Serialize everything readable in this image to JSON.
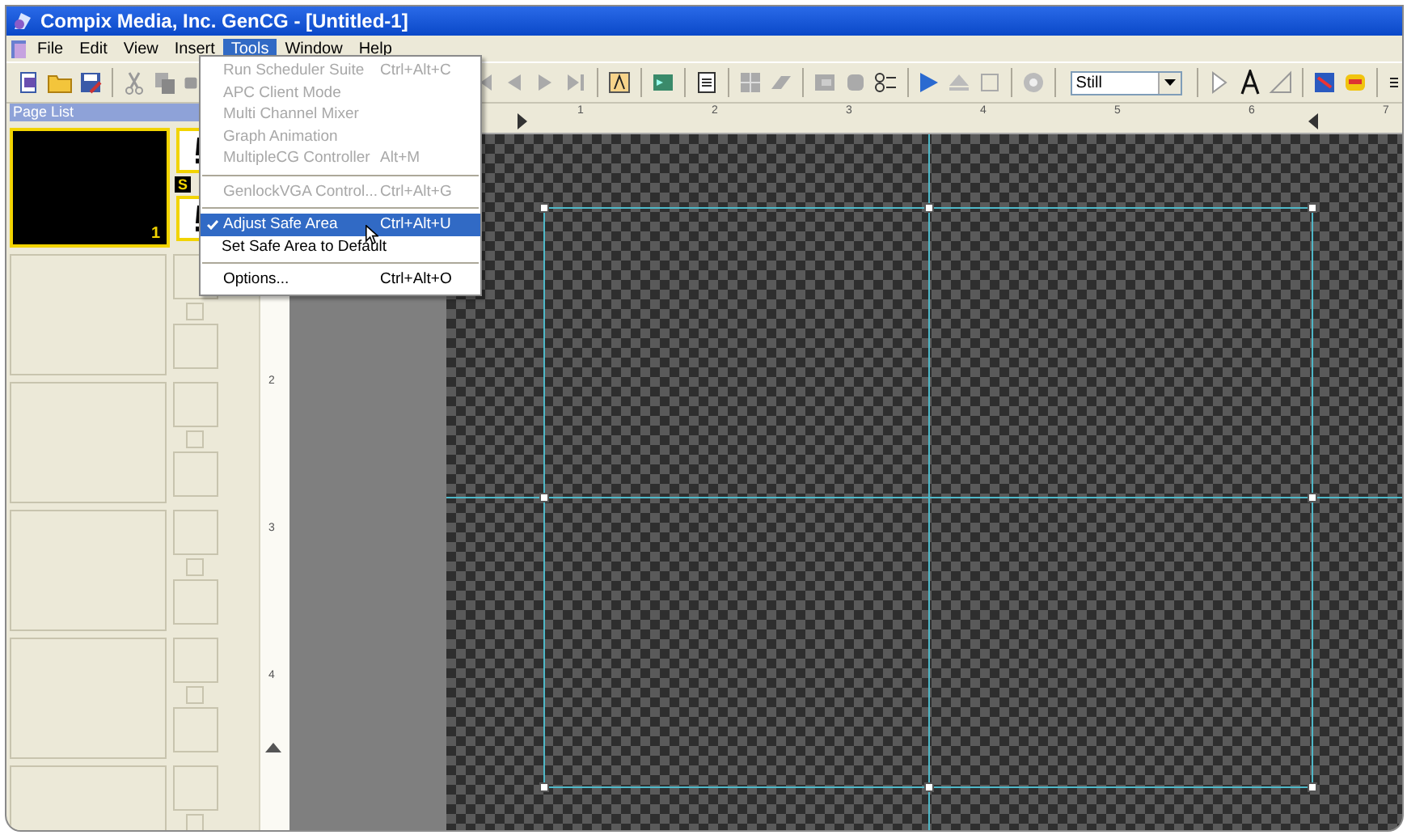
{
  "window": {
    "title": "Compix Media, Inc. GenCG - [Untitled-1]"
  },
  "menu_bar": [
    {
      "label": "File",
      "selected": false
    },
    {
      "label": "Edit",
      "selected": false
    },
    {
      "label": "View",
      "selected": false
    },
    {
      "label": "Insert",
      "selected": false
    },
    {
      "label": "Tools",
      "selected": true
    },
    {
      "label": "Window",
      "selected": false
    },
    {
      "label": "Help",
      "selected": false
    }
  ],
  "tools_menu": [
    {
      "kind": "item",
      "label": "Run Scheduler Suite",
      "shortcut": "Ctrl+Alt+C",
      "disabled": true,
      "checked": false,
      "selected": false
    },
    {
      "kind": "item",
      "label": "APC Client Mode",
      "disabled": true,
      "checked": false,
      "selected": false
    },
    {
      "kind": "item",
      "label": "Multi Channel Mixer",
      "disabled": true,
      "checked": false,
      "selected": false
    },
    {
      "kind": "item",
      "label": "Graph Animation",
      "disabled": true,
      "checked": false,
      "selected": false
    },
    {
      "kind": "item",
      "label": "MultipleCG Controller",
      "shortcut": "Alt+M",
      "disabled": true,
      "checked": false,
      "selected": false
    },
    {
      "kind": "separator"
    },
    {
      "kind": "item",
      "label": "GenlockVGA Control...",
      "shortcut": "Ctrl+Alt+G",
      "disabled": true,
      "checked": false,
      "selected": false
    },
    {
      "kind": "separator"
    },
    {
      "kind": "item",
      "label": "Adjust Safe Area",
      "shortcut": "Ctrl+Alt+U",
      "disabled": false,
      "checked": true,
      "selected": true
    },
    {
      "kind": "item",
      "label": "Set Safe Area to Default",
      "disabled": false,
      "checked": false,
      "selected": false
    },
    {
      "kind": "separator"
    },
    {
      "kind": "item",
      "label": "Options...",
      "shortcut": "Ctrl+Alt+O",
      "disabled": false,
      "checked": false,
      "selected": false
    }
  ],
  "toolbar": {
    "mode_select": {
      "value": "Still"
    }
  },
  "page_list": {
    "title": "Page List",
    "badge": "S",
    "pages": [
      {
        "number": "1",
        "selected": true
      },
      {
        "selected": false,
        "checked": false
      },
      {
        "selected": false,
        "checked": false
      },
      {
        "selected": false,
        "checked": false
      },
      {
        "selected": false,
        "checked": false
      },
      {
        "selected": false,
        "checked": false
      }
    ]
  },
  "rulers": {
    "horizontal": [
      "1",
      "2",
      "3",
      "4",
      "5",
      "6",
      "7"
    ],
    "vertical": [
      "2",
      "3",
      "4"
    ]
  }
}
